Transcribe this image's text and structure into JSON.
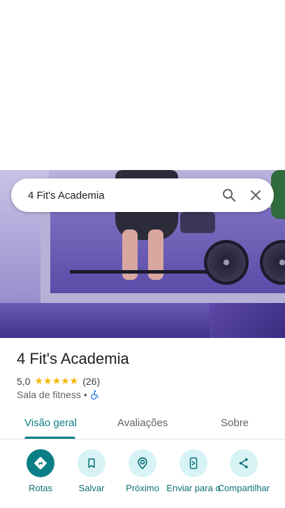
{
  "search": {
    "query": "4 Fit's Academia"
  },
  "place": {
    "title": "4 Fit's Academia",
    "rating": "5,0",
    "stars": "★★★★★",
    "review_count": "(26)",
    "category": "Sala de fitness",
    "separator": "•"
  },
  "tabs": [
    {
      "label": "Visão geral",
      "selected": true
    },
    {
      "label": "Avaliações",
      "selected": false
    },
    {
      "label": "Sobre",
      "selected": false
    }
  ],
  "actions": [
    {
      "label": "Rotas",
      "icon": "directions-icon"
    },
    {
      "label": "Salvar",
      "icon": "bookmark-icon"
    },
    {
      "label": "Próximo",
      "icon": "nearby-icon"
    },
    {
      "label": "Enviar para o",
      "icon": "send-to-phone-icon"
    },
    {
      "label": "Compartilhar",
      "icon": "share-icon"
    }
  ],
  "colors": {
    "accent": "#0b7f86",
    "accent_light": "#d7f3f6",
    "star": "#f6b600"
  }
}
